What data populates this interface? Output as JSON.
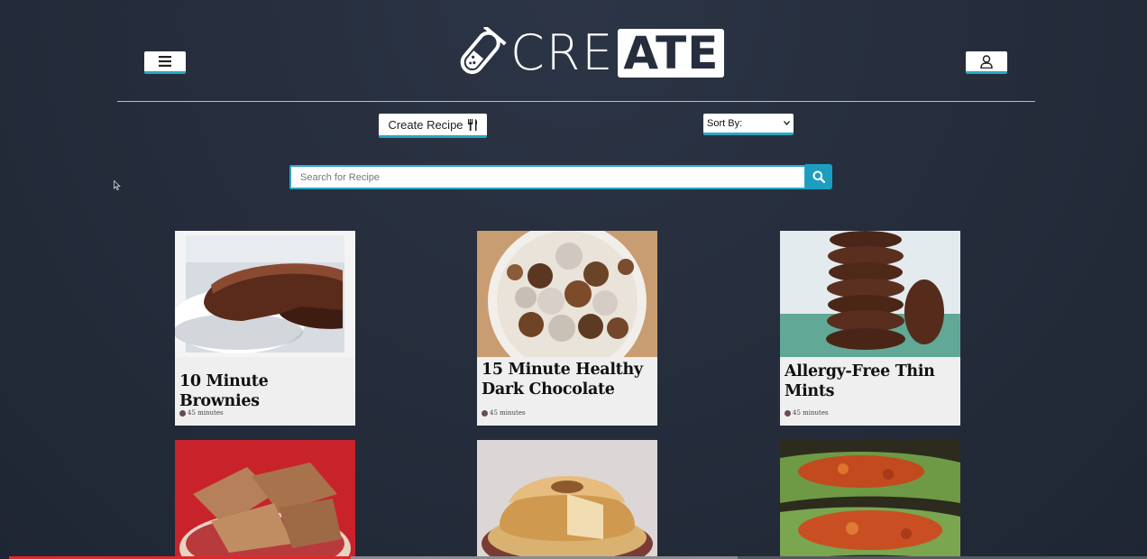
{
  "header": {
    "logo_text_outline": "CRE",
    "logo_text_filled": "ATE",
    "menu_icon": "hamburger-menu-icon",
    "user_icon": "user-icon",
    "divider_color": "#b9bec7"
  },
  "toolbar": {
    "create_label": "Create Recipe",
    "create_icon": "fork-knife-icon",
    "sort_selected": "Sort By:"
  },
  "search": {
    "placeholder": "Search for Recipe",
    "button_icon": "search-icon"
  },
  "recipes": [
    {
      "title": "10 Minute Brownies",
      "time": "45 minutes"
    },
    {
      "title": "15 Minute Healthy Dark Chocolate",
      "time": "45 minutes"
    },
    {
      "title": "Allergy-Free Thin Mints",
      "time": "45 minutes"
    },
    {
      "title": "",
      "time": ""
    },
    {
      "title": "",
      "time": ""
    },
    {
      "title": "",
      "time": ""
    }
  ],
  "colors": {
    "accent": "#2aa8c4",
    "search_button": "#1d9ec1",
    "background": "#262e3d",
    "card": "#f0eff0",
    "progress": "#e1282b"
  },
  "video_progress": {
    "played_fraction": 0.3,
    "buffered_fraction": 0.64
  }
}
